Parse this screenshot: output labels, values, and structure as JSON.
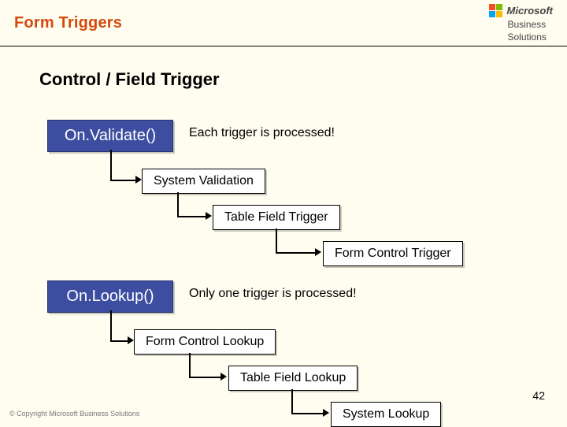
{
  "header": {
    "title": "Form Triggers",
    "logo": {
      "top": "Microsoft",
      "line1": "Business",
      "line2": "Solutions"
    }
  },
  "section_title": "Control / Field Trigger",
  "validate": {
    "trigger_label": "On.Validate()",
    "note": "Each trigger is processed!",
    "steps": {
      "a": "System Validation",
      "b": "Table Field Trigger",
      "c": "Form Control Trigger"
    }
  },
  "lookup": {
    "trigger_label": "On.Lookup()",
    "note": "Only one trigger is processed!",
    "steps": {
      "a": "Form Control Lookup",
      "b": "Table Field Lookup",
      "c": "System Lookup"
    }
  },
  "page_number": "42",
  "copyright": "© Copyright Microsoft Business Solutions"
}
